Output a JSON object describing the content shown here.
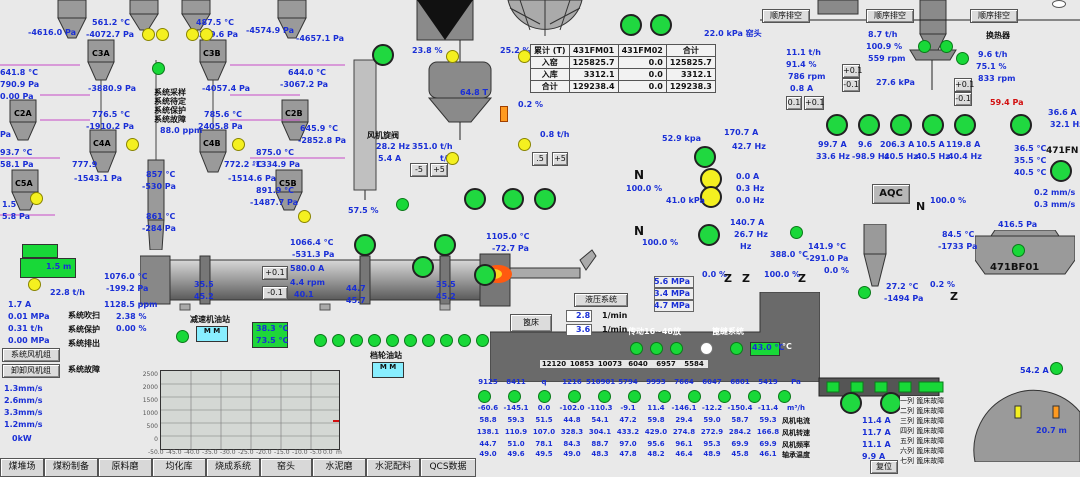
{
  "colors": {
    "running": "#18d838",
    "standby": "#f4f020",
    "value_blue": "#1a2fd6",
    "alarm_red": "#d21010",
    "kiln_flame": "#ff5a10"
  },
  "preheater": {
    "top_left_pressure": "-4616.0 Pa",
    "c1_left": {
      "temp": "561.2 °C",
      "pressure": "-4072.7 Pa"
    },
    "c1_right": {
      "temp": "487.5 °C",
      "pressure": "-4349.6 Pa"
    },
    "c1_right2_pressure": "-4574.9 Pa",
    "top_right_pressure": "-4657.1 Pa",
    "left_edge": {
      "temp": "641.8 °C",
      "pressure": "790.9 Pa"
    },
    "c3a": {
      "label": "C3A",
      "pressure": "-3880.9 Pa"
    },
    "c3b": {
      "label": "C3B",
      "pressure": "-4057.4 Pa"
    },
    "right_edge": {
      "temp": "644.0 °C",
      "pressure": "-3067.2 Pa"
    },
    "c2a_pressure": "0.00 Pa",
    "c2a_label": "C2A",
    "c2b_label": "C2B",
    "c4a": {
      "label": "C4A",
      "temp": "776.5 °C",
      "pressure": "-1910.2 Pa"
    },
    "c4b": {
      "label": "C4B",
      "temp": "785.6 °C",
      "pressure": "2405.8 Pa"
    },
    "c4_right": {
      "temp": "645.9 °C",
      "pressure": "-2852.8 Pa"
    },
    "sys_menu": [
      "系统采样",
      "系统待定",
      "系统保护",
      "系统故障"
    ],
    "ppm": "88.0 ppm",
    "left_pa": "Pa",
    "c5_left_temp": "93.7 °C",
    "c5_left_pa": "58.1 Pa",
    "c4a_low": {
      "temp": "777.9",
      "pressure": "-1543.1 Pa"
    },
    "c4b_low": {
      "temp": "772.2 °C",
      "pressure": "-1514.6 Pa"
    },
    "c4b_right": {
      "temp": "875.0 °C",
      "pressure": "-1334.9 Pa"
    },
    "c5a": {
      "label": "C5A",
      "temp": "1.5",
      "pressure": "5.8 Pa"
    },
    "c5b": {
      "label": "C5B",
      "temp": "891.9 °C",
      "pressure": "-1487.7 Pa"
    },
    "calc_temp": "857 °C",
    "calc_pa": "-530 Pa",
    "calc_temp2": "861 °C",
    "calc_pa2": "-284 Pa"
  },
  "top_center": {
    "left_pct": "23.8 %",
    "right_pct": "25.2 %",
    "silo_value": "64.8 T",
    "level_pct": "0.2 %",
    "fan_label": "风机旋阀",
    "fan_hz": "28.2 Hz",
    "fan_a": "5.4 A",
    "feed_t": "351.0 t/h",
    "feed_th": "t/h",
    "feed_val": "0.8 t/h",
    "step_minus": "-5",
    "step_plus": "+5",
    "step_minus2": ".5",
    "step_plus2": "+5",
    "feed_pct": "57.5 %"
  },
  "table": {
    "headers": [
      "累计 (T)",
      "431FM01",
      "431FM02",
      "合计"
    ],
    "rows": [
      [
        "入窑",
        "125825.7",
        "0.0",
        "125825.7"
      ],
      [
        "入库",
        "3312.1",
        "0.0",
        "3312.1"
      ],
      [
        "合计",
        "129238.4",
        "0.0",
        "129238.3"
      ]
    ]
  },
  "top_right": {
    "kpa": "22.0 kPa 窑头",
    "btn_seq1": "顺序排空",
    "btn_seq2": "顺序排空",
    "btn_seq3": "顺序排空",
    "mill1": {
      "th": "11.1 t/h",
      "pct": "91.4 %",
      "rpm": "786 rpm",
      "a": "0.8 A"
    },
    "mill2": {
      "th": "8.7 t/h",
      "pct": "100.9 %",
      "rpm": "559 rpm",
      "kpa": "27.6 kPa"
    },
    "mill3": {
      "th": "9.6 t/h",
      "pct": "75.1 %",
      "rpm": "833 rpm",
      "pa": "59.4 Pa"
    },
    "heater": "换热器",
    "plus": "+0.1",
    "minus": "-0.1",
    "small1": "0.1",
    "small2": "+0.1",
    "right_col": {
      "a": "36.6 A",
      "b": "32.1 Hz"
    },
    "fans": [
      {
        "a": "99.7 A",
        "hz": "33.6 Hz"
      },
      {
        "a": "9.6",
        "hz": "-98.9 Hz"
      },
      {
        "a": "206.3 A",
        "hz": "40.5 Hz"
      },
      {
        "a": "10.5 A",
        "hz": "40.5 Hz"
      },
      {
        "a": "119.8 A",
        "hz": "40.4 Hz"
      }
    ],
    "right_temps": [
      "36.5 °C",
      "35.5 °C",
      "40.5 °C"
    ],
    "fn_label": "471FN",
    "mms1": "0.2 mm/s",
    "mms2": "0.3 mm/s",
    "aqc": "AQC",
    "n1": "N",
    "pct_right": "100.0 %",
    "bf_label": "471BF01",
    "bf_pa": "416.5 Pa",
    "kiln_out_temp": "84.5 °C",
    "kiln_out_pa": "-1733 Pa",
    "cooler_temp": "141.9 °C",
    "cooler_pa": "-291.0 Pa",
    "cooler_pct": "0.0 %",
    "cool2_temp": "27.2 °C",
    "cool2_pa": "-1494 Pa",
    "cool2_pct": "0.2 %",
    "temp_388": "388.0 °C",
    "pct_100_c": "100.0 %",
    "pct_00": "0.0 %"
  },
  "center_right": {
    "kpa": "52.9 kpa",
    "fan_a": "170.7 A",
    "fan_hz": "42.7 Hz",
    "n_label": "N",
    "pct": "100.0 %",
    "kpa2": "41.0 kPa",
    "a2": "0.0 A",
    "hz2": "0.3 Hz",
    "a3": "0.0 Hz",
    "n_label2": "N",
    "pct2": "100.0 %",
    "a4": "140.7 A",
    "hz4": "26.7 Hz",
    "hz5": "Hz"
  },
  "kiln": {
    "burner_temp": "1105.0 °C",
    "burner_pa": "-72.7 Pa",
    "inlet_temp": "1066.4 °C",
    "inlet_pa": "-531.3 Pa",
    "left_temp": "1076.0 °C",
    "left_pa": "-199.2 Pa",
    "ppm": "1128.5 ppm",
    "o2": "2.38 %",
    "co": "0.00 %",
    "amp": "580.0 A",
    "rpm": "4.4 rpm",
    "rpm2": "40.1",
    "t1": "35.5",
    "t2": "45.2",
    "t3": "44.7",
    "t4": "45.7",
    "t5": "35.5",
    "t6": "45.2",
    "plus": "+0.1",
    "minus": "-0.1",
    "gear_label": "减速机油站",
    "gear_temp": "38.3 °C",
    "gear_temp2": "73.5 °C",
    "roller_label": "档轮油站"
  },
  "left_bottom": {
    "level": "1.5 m",
    "flow": "22.8 t/h",
    "mpa1": "1.7 A",
    "mpa2": "0.01 MPa",
    "mpa3": "0.31 t/h",
    "mpa4": "0.00 MPa",
    "sys_blow": "系统吹扫",
    "sys_prot": "系统保护",
    "sys_exh": "系统排出",
    "sys_fault": "系统故障",
    "btn_fan": "系统风机组",
    "btn_unload": "卸卸风机组",
    "mms": [
      "1.3mm/s",
      "2.6mm/s",
      "3.3mm/s",
      "1.2mm/s"
    ],
    "kw": "0kW"
  },
  "chart": {
    "x_ticks": [
      "-50.0",
      "-45.0",
      "-40.0",
      "-35.0",
      "-30.0",
      "-25.0",
      "-20.0",
      "-15.0",
      "-10.0",
      "-5.0",
      "0.0"
    ],
    "y_ticks": [
      "2500",
      "2000",
      "1500",
      "1000",
      "500",
      "0"
    ],
    "x_unit": "m"
  },
  "cooler": {
    "hydraulic_label": "液压系统",
    "mpa1": "5.6 MPa",
    "mpa2": "3.4 MPa",
    "mpa3": "4.7 MPa",
    "btn_bed": "篦床",
    "rpm1": "2.8",
    "rpm2": "3.6",
    "unit": "1/min",
    "fan_group": "传动16~48放",
    "grate": "篦缝系统",
    "temp": "43.0 °C",
    "row1": [
      "12120",
      "10853",
      "10073",
      "6040",
      "6957",
      "5584"
    ],
    "row2": [
      "9125",
      "8411",
      "q",
      "1216",
      "510901",
      "5794",
      "9993",
      "7664",
      "6047",
      "6801",
      "5419",
      "Pa"
    ],
    "row3": [
      "-60.6",
      "-145.1",
      "0.0",
      "-102.0",
      "-110.3",
      "-9.1",
      "11.4",
      "-146.1",
      "-12.2",
      "-150.4",
      "-11.4",
      "m³/h"
    ],
    "row4": [
      "58.8",
      "59.3",
      "51.5",
      "44.8",
      "54.1",
      "47.2",
      "59.8",
      "29.4",
      "59.0",
      "58.7",
      "59.3"
    ],
    "row5": [
      "138.1",
      "110.9",
      "107.0",
      "328.3",
      "304.1",
      "433.2",
      "429.0",
      "274.8",
      "272.9",
      "284.2",
      "166.8"
    ],
    "row6": [
      "44.7",
      "51.0",
      "78.1",
      "84.3",
      "88.7",
      "97.0",
      "95.6",
      "96.1",
      "95.3",
      "69.9",
      "69.9"
    ],
    "row7": [
      "49.0",
      "49.6",
      "49.5",
      "49.0",
      "48.3",
      "47.8",
      "48.2",
      "46.4",
      "48.9",
      "45.8",
      "46.1"
    ],
    "row_units": [
      "风机电流",
      "风机转速",
      "风机频率",
      "轴承温度",
      "出口温度"
    ]
  },
  "bottom_right": {
    "a1": "54.2 A",
    "amps": [
      "11.4 A",
      "11.7 A",
      "11.1 A",
      "9.9 A"
    ],
    "reset": "复位",
    "temp": "20.7 m",
    "lines": [
      "一列 篦床故障",
      "二列 篦床故障",
      "三列 篦床故障",
      "四列 篦床故障",
      "五列 篦床故障",
      "六列 篦床故障",
      "七列 篦床故障"
    ]
  },
  "tabs": [
    "煤堆场",
    "煤粉制备",
    "原料磨",
    "均化库",
    "烧成系统",
    "窑头",
    "水泥磨",
    "水泥配料",
    "QCS数据"
  ]
}
